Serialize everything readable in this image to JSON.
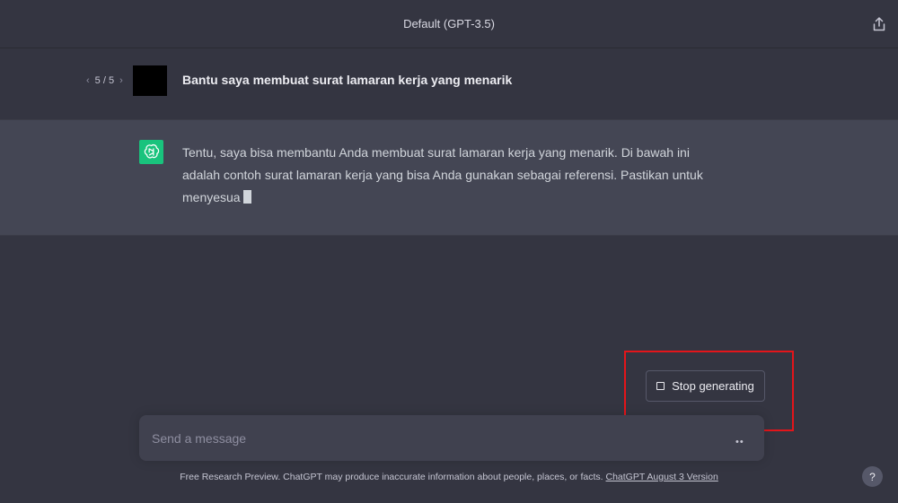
{
  "header": {
    "title": "Default (GPT-3.5)",
    "share_icon": "share-icon"
  },
  "conversation": {
    "user": {
      "pager": "5 / 5",
      "prev_icon": "chevron-left-icon",
      "next_icon": "chevron-right-icon",
      "message": "Bantu saya membuat surat lamaran kerja yang menarik"
    },
    "assistant": {
      "avatar_icon": "openai-logo-icon",
      "message": "Tentu, saya bisa membantu Anda membuat surat lamaran kerja yang menarik. Di bawah ini adalah contoh surat lamaran kerja yang bisa Anda gunakan sebagai referensi. Pastikan untuk menyesua"
    }
  },
  "stop_button": {
    "label": "Stop generating",
    "icon": "stop-square-icon"
  },
  "composer": {
    "placeholder": "Send a message",
    "value": "",
    "status": "••"
  },
  "footer": {
    "text": "Free Research Preview. ChatGPT may produce inaccurate information about people, places, or facts.",
    "link": "ChatGPT August 3 Version"
  },
  "help": {
    "label": "?"
  },
  "colors": {
    "background": "#343541",
    "assistant_row": "#444654",
    "input": "#40414f",
    "accent_green": "#19c37d",
    "highlight_red": "#e3151a"
  }
}
